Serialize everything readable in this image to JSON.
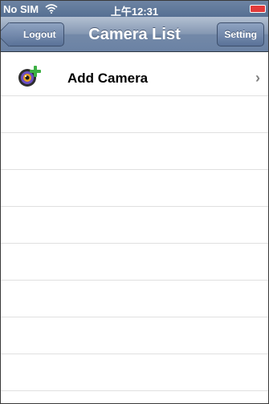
{
  "status_bar": {
    "carrier": "No SIM",
    "time": "上午12:31",
    "icons": [
      "wifi-icon",
      "battery-icon"
    ],
    "battery_color": "#e23b3b"
  },
  "nav_bar": {
    "title": "Camera List",
    "left_button": "Logout",
    "right_button": "Setting"
  },
  "list": {
    "items": [
      {
        "label": "Add Camera",
        "icon": "camera-add-icon",
        "accessory": "chevron-right-icon"
      }
    ],
    "empty_rows": 8
  },
  "colors": {
    "nav_bar": "#7389a8",
    "separator": "#e0e0e0",
    "background": "#ffffff"
  }
}
